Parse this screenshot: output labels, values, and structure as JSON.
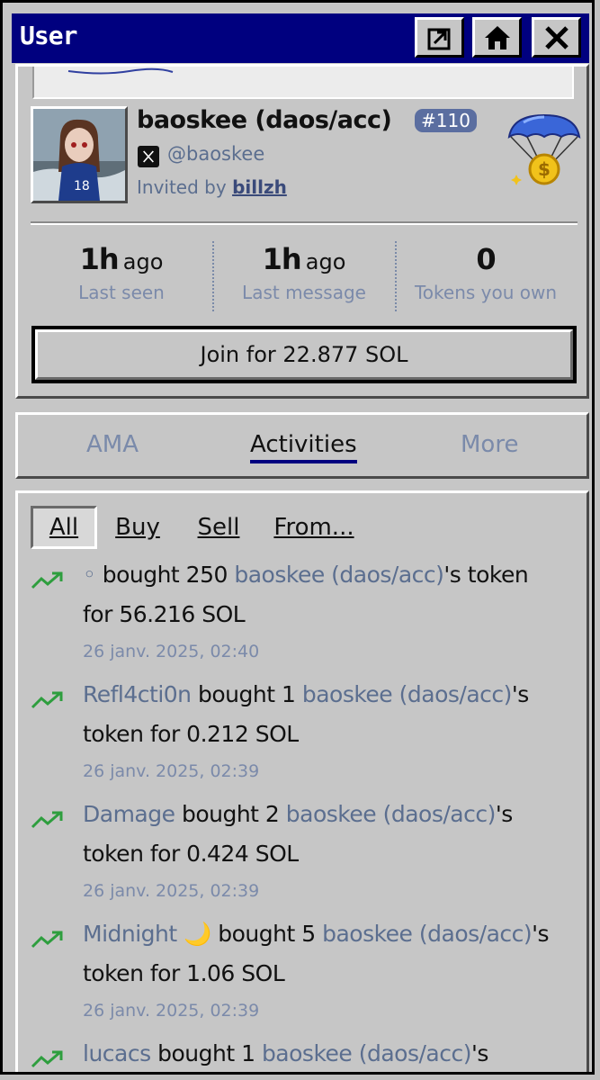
{
  "window": {
    "title": "User",
    "buttons": [
      "share-icon",
      "home-icon",
      "close-icon"
    ]
  },
  "profile": {
    "name": "baoskee (daos/acc)",
    "rank_badge": "#110",
    "handle": "@baoskee",
    "invited_prefix": "Invited by",
    "invited_by": "billzh"
  },
  "stats": [
    {
      "value": "1h",
      "unit": "ago",
      "label": "Last seen"
    },
    {
      "value": "1h",
      "unit": "ago",
      "label": "Last message"
    },
    {
      "value": "0",
      "unit": "",
      "label": "Tokens you own"
    }
  ],
  "join_label": "Join for 22.877 SOL",
  "tabs": [
    {
      "label": "AMA",
      "active": false
    },
    {
      "label": "Activities",
      "active": true
    },
    {
      "label": "More",
      "active": false
    }
  ],
  "filters": [
    {
      "label": "All",
      "active": true
    },
    {
      "label": "Buy",
      "active": false
    },
    {
      "label": "Sell",
      "active": false
    },
    {
      "label": "From...",
      "active": false
    }
  ],
  "activities": [
    {
      "actor": "◦",
      "verb": "bought 250",
      "target": "baoskee (daos/acc)",
      "suffix": "'s token",
      "line2": "for 56.216 SOL",
      "time": "26 janv. 2025, 02:40"
    },
    {
      "actor": "Refl4cti0n",
      "verb": "bought 1",
      "target": "baoskee (daos/acc)",
      "suffix": "'s",
      "line2": "token for 0.212 SOL",
      "time": "26 janv. 2025, 02:39"
    },
    {
      "actor": "Damage",
      "verb": "bought 2",
      "target": "baoskee (daos/acc)",
      "suffix": "'s",
      "line2": "token for 0.424 SOL",
      "time": "26 janv. 2025, 02:39"
    },
    {
      "actor": "Midnight 🌙",
      "verb": "bought 5",
      "target": "baoskee (daos/acc)",
      "suffix": "'s",
      "line2": "token for 1.06 SOL",
      "time": "26 janv. 2025, 02:39"
    },
    {
      "actor": "lucacs",
      "verb": "bought 1",
      "target": "baoskee (daos/acc)",
      "suffix": "'s",
      "line2": "",
      "time": ""
    }
  ],
  "colors": {
    "titlebar": "#00007f",
    "panel": "#c6c6c6",
    "link": "#5b6e8f",
    "trend_up": "#2e9e3e"
  }
}
